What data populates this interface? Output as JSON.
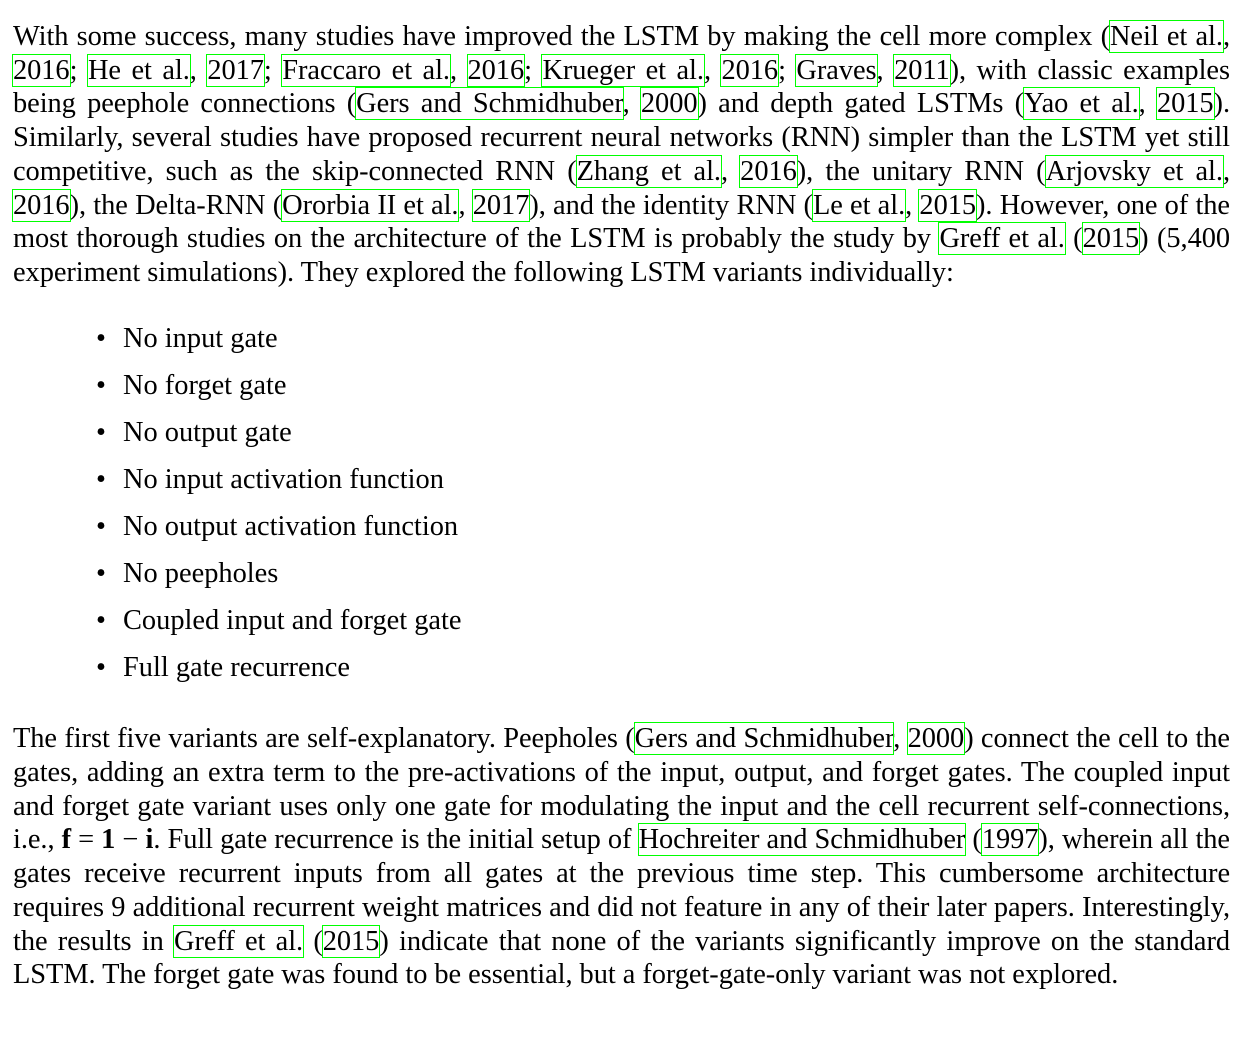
{
  "paragraph1": {
    "t1": "With some success, many studies have improved the LSTM by making the cell more complex (",
    "c1a": "Neil et al.",
    "t2": ", ",
    "c1b": "2016",
    "t3": "; ",
    "c2a": "He et al.",
    "t4": ", ",
    "c2b": "2017",
    "t5": "; ",
    "c3a": "Fraccaro et al.",
    "t6": ", ",
    "c3b": "2016",
    "t7": "; ",
    "c4a": "Krueger et al.",
    "t8": ", ",
    "c4b": "2016",
    "t9": "; ",
    "c5a": "Graves",
    "t10": ", ",
    "c5b": "2011",
    "t11": "), with classic examples being peephole connections (",
    "c6a": "Gers and Schmidhuber",
    "t12": ", ",
    "c6b": "2000",
    "t13": ") and depth gated LSTMs (",
    "c7a": "Yao et al.",
    "t14": ", ",
    "c7b": "2015",
    "t15": "). Similarly, several studies have proposed recurrent neural networks (RNN) simpler than the LSTM yet still competitive, such as the skip-connected RNN (",
    "c8a": "Zhang et al.",
    "t16": ", ",
    "c8b": "2016",
    "t17": "), the unitary RNN (",
    "c9a": "Arjovsky et al.",
    "t18": ", ",
    "c9b": "2016",
    "t19": "), the Delta-RNN (",
    "c10a": "Ororbia II et al.",
    "t20": ", ",
    "c10b": "2017",
    "t21": "), and the identity RNN (",
    "c11a": "Le et al.",
    "t22": ", ",
    "c11b": "2015",
    "t23": "). However, one of the most thorough studies on the architecture of the LSTM is probably the study by ",
    "c12a": "Greff et al.",
    "t24": " (",
    "c12b": "2015",
    "t25": ") (5,400 experiment simulations). They explored the following LSTM variants individually:"
  },
  "variants": [
    "No input gate",
    "No forget gate",
    "No output gate",
    "No input activation function",
    "No output activation function",
    "No peepholes",
    "Coupled input and forget gate",
    "Full gate recurrence"
  ],
  "bullet_glyph": "•",
  "paragraph2": {
    "t1": "The first five variants are self-explanatory. Peepholes (",
    "c1a": "Gers and Schmidhuber",
    "t2": ", ",
    "c1b": "2000",
    "t3": ") connect the cell to the gates, adding an extra term to the pre-activations of the input, output, and forget gates. The coupled input and forget gate variant uses only one gate for modulating the input and the cell recurrent self-connections, i.e., ",
    "m1": "f",
    "m2": " = ",
    "m3": "1",
    "m4": " − ",
    "m5": "i",
    "t4": ". Full gate recurrence is the initial setup of ",
    "c2a": "Hochreiter and Schmidhuber",
    "t5": " (",
    "c2b": "1997",
    "t6": "), wherein all the gates receive recurrent inputs from all gates at the previous time step. This cumbersome architecture requires 9 additional recurrent weight matrices and did not feature in any of their later papers. Interestingly, the results in ",
    "c3a": "Greff et al.",
    "t7": " (",
    "c3b": "2015",
    "t8": ") indicate that none of the variants significantly improve on the standard LSTM. The forget gate was found to be essential, but a forget-gate-only variant was not explored."
  },
  "colors": {
    "citation_box": "#00ff00",
    "text": "#000000",
    "background": "#ffffff"
  }
}
